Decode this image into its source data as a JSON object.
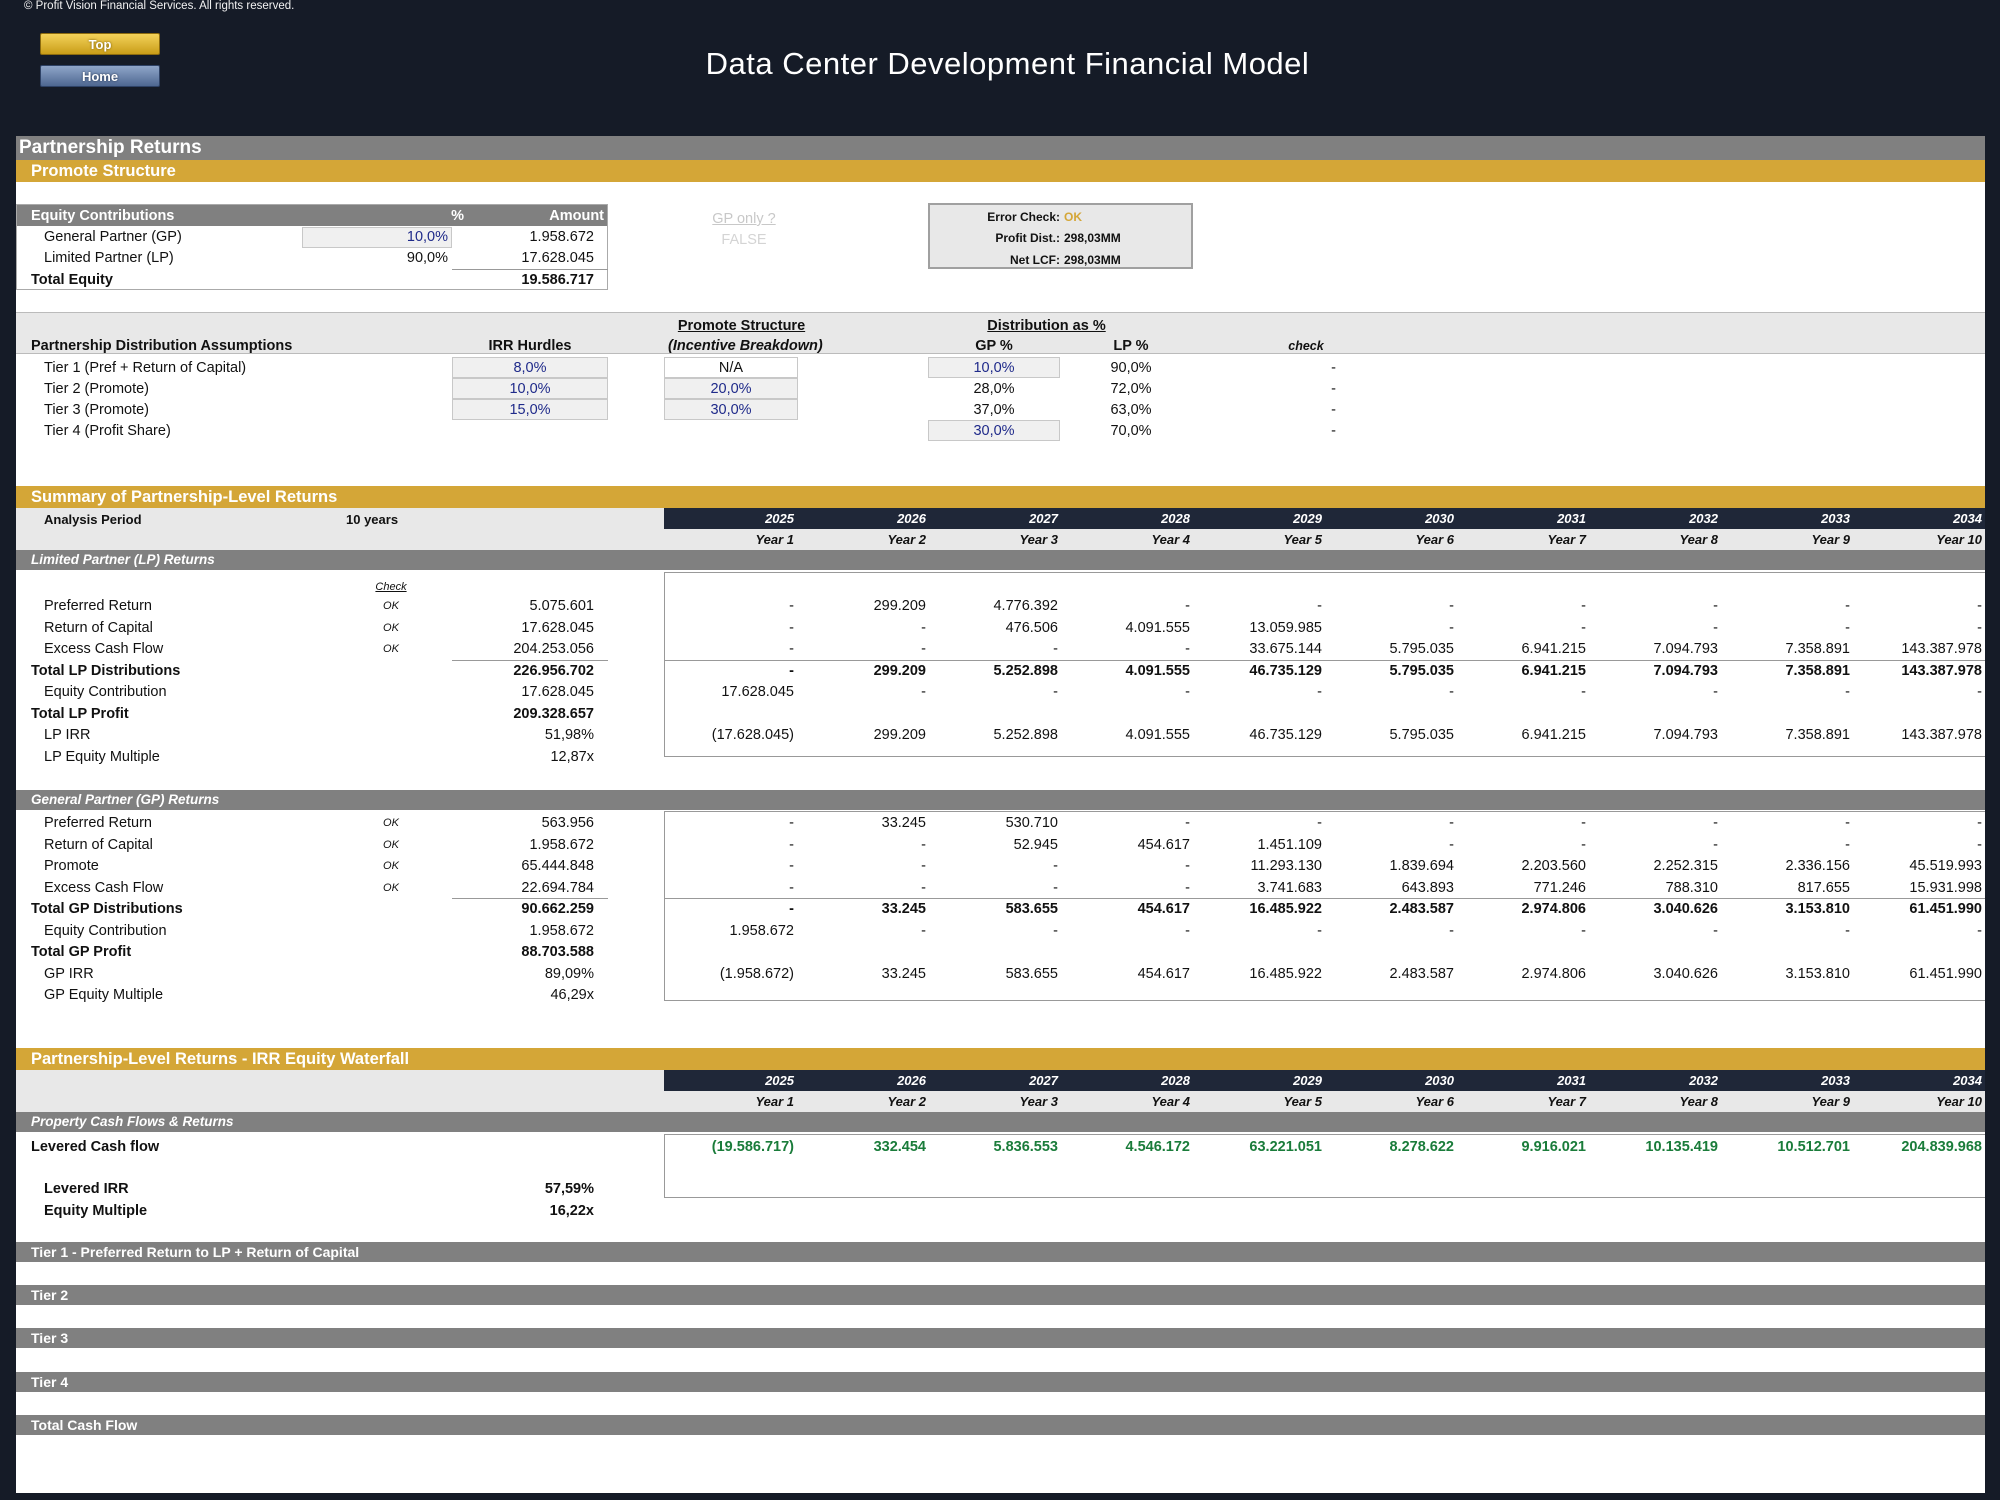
{
  "header": {
    "copyright": "© Profit Vision Financial Services. All rights reserved.",
    "title": "Data Center Development Financial Model",
    "top_button": "Top",
    "home_button": "Home"
  },
  "sections": {
    "partnership_returns": "Partnership Returns",
    "promote_structure": "Promote Structure",
    "summary": "Summary of Partnership-Level Returns",
    "waterfall": "Partnership-Level Returns - IRR Equity Waterfall",
    "tier1": "Tier 1 - Preferred Return to LP + Return of Capital",
    "tier2": "Tier 2",
    "tier3": "Tier 3",
    "tier4": "Tier 4",
    "total_cf": "Total Cash Flow"
  },
  "equity": {
    "header": {
      "label": "Equity Contributions",
      "pct": "%",
      "amount": "Amount"
    },
    "rows": [
      {
        "label": "General Partner (GP)",
        "pct": "10,0%",
        "amount": "1.958.672"
      },
      {
        "label": "Limited Partner (LP)",
        "pct": "90,0%",
        "amount": "17.628.045"
      }
    ],
    "total": {
      "label": "Total Equity",
      "amount": "19.586.717"
    },
    "gp_only_label": "GP only ?",
    "gp_only_value": "FALSE"
  },
  "error_check": {
    "error_label": "Error Check:",
    "error_value": "OK",
    "profit_label": "Profit Dist.:",
    "profit_value": "298,03MM",
    "lcf_label": "Net LCF:",
    "lcf_value": "298,03MM"
  },
  "distribution": {
    "heading_promote": "Promote Structure",
    "heading_dist": "Distribution as %",
    "col_title": "Partnership Distribution Assumptions",
    "col_irr": "IRR Hurdles",
    "col_promote": "(Incentive Breakdown)",
    "col_gp": "GP %",
    "col_lp": "LP %",
    "col_check": "check",
    "tiers": [
      {
        "label": "Tier 1 (Pref + Return of Capital)",
        "irr": "8,0%",
        "promote": "N/A",
        "gp": "10,0%",
        "lp": "90,0%",
        "check": "-"
      },
      {
        "label": "Tier 2 (Promote)",
        "irr": "10,0%",
        "promote": "20,0%",
        "gp": "28,0%",
        "lp": "72,0%",
        "check": "-"
      },
      {
        "label": "Tier 3 (Promote)",
        "irr": "15,0%",
        "promote": "30,0%",
        "gp": "37,0%",
        "lp": "63,0%",
        "check": "-"
      },
      {
        "label": "Tier 4 (Profit Share)",
        "irr": "",
        "promote": "",
        "gp": "30,0%",
        "lp": "70,0%",
        "check": "-"
      }
    ]
  },
  "analysis_period": {
    "label": "Analysis Period",
    "value": "10 years"
  },
  "years": [
    "2025",
    "2026",
    "2027",
    "2028",
    "2029",
    "2030",
    "2031",
    "2032",
    "2033",
    "2034"
  ],
  "year_labels": [
    "Year 1",
    "Year 2",
    "Year 3",
    "Year 4",
    "Year 5",
    "Year 6",
    "Year 7",
    "Year 8",
    "Year 9",
    "Year 10"
  ],
  "check_label": "Check",
  "lp": {
    "title": "Limited Partner (LP) Returns",
    "rows": [
      {
        "label": "Preferred Return",
        "check": "OK",
        "total": "5.075.601",
        "vals": [
          "-",
          "299.209",
          "4.776.392",
          "-",
          "-",
          "-",
          "-",
          "-",
          "-",
          "-"
        ]
      },
      {
        "label": "Return of Capital",
        "check": "OK",
        "total": "17.628.045",
        "vals": [
          "-",
          "-",
          "476.506",
          "4.091.555",
          "13.059.985",
          "-",
          "-",
          "-",
          "-",
          "-"
        ]
      },
      {
        "label": "Excess Cash Flow",
        "check": "OK",
        "total": "204.253.056",
        "vals": [
          "-",
          "-",
          "-",
          "-",
          "33.675.144",
          "5.795.035",
          "6.941.215",
          "7.094.793",
          "7.358.891",
          "143.387.978"
        ]
      },
      {
        "label": "Total LP Distributions",
        "bold": true,
        "total": "226.956.702",
        "vals": [
          "-",
          "299.209",
          "5.252.898",
          "4.091.555",
          "46.735.129",
          "5.795.035",
          "6.941.215",
          "7.094.793",
          "7.358.891",
          "143.387.978"
        ]
      },
      {
        "label": "Equity Contribution",
        "total": "17.628.045",
        "vals": [
          "17.628.045",
          "-",
          "-",
          "-",
          "-",
          "-",
          "-",
          "-",
          "-",
          "-"
        ]
      },
      {
        "label": "Total LP Profit",
        "bold": true,
        "total": "209.328.657",
        "vals": [
          "",
          "",
          "",
          "",
          "",
          "",
          "",
          "",
          "",
          ""
        ]
      },
      {
        "label": "LP IRR",
        "total": "51,98%",
        "vals": [
          "(17.628.045)",
          "299.209",
          "5.252.898",
          "4.091.555",
          "46.735.129",
          "5.795.035",
          "6.941.215",
          "7.094.793",
          "7.358.891",
          "143.387.978"
        ]
      },
      {
        "label": "LP Equity Multiple",
        "total": "12,87x",
        "vals": [
          "",
          "",
          "",
          "",
          "",
          "",
          "",
          "",
          "",
          ""
        ]
      }
    ]
  },
  "gp": {
    "title": "General Partner (GP) Returns",
    "rows": [
      {
        "label": "Preferred Return",
        "check": "OK",
        "total": "563.956",
        "vals": [
          "-",
          "33.245",
          "530.710",
          "-",
          "-",
          "-",
          "-",
          "-",
          "-",
          "-"
        ]
      },
      {
        "label": "Return of Capital",
        "check": "OK",
        "total": "1.958.672",
        "vals": [
          "-",
          "-",
          "52.945",
          "454.617",
          "1.451.109",
          "-",
          "-",
          "-",
          "-",
          "-"
        ]
      },
      {
        "label": "Promote",
        "check": "OK",
        "total": "65.444.848",
        "vals": [
          "-",
          "-",
          "-",
          "-",
          "11.293.130",
          "1.839.694",
          "2.203.560",
          "2.252.315",
          "2.336.156",
          "45.519.993"
        ]
      },
      {
        "label": "Excess Cash Flow",
        "check": "OK",
        "total": "22.694.784",
        "vals": [
          "-",
          "-",
          "-",
          "-",
          "3.741.683",
          "643.893",
          "771.246",
          "788.310",
          "817.655",
          "15.931.998"
        ]
      },
      {
        "label": "Total GP Distributions",
        "bold": true,
        "total": "90.662.259",
        "vals": [
          "-",
          "33.245",
          "583.655",
          "454.617",
          "16.485.922",
          "2.483.587",
          "2.974.806",
          "3.040.626",
          "3.153.810",
          "61.451.990"
        ]
      },
      {
        "label": "Equity Contribution",
        "total": "1.958.672",
        "vals": [
          "1.958.672",
          "-",
          "-",
          "-",
          "-",
          "-",
          "-",
          "-",
          "-",
          "-"
        ]
      },
      {
        "label": "Total GP Profit",
        "bold": true,
        "total": "88.703.588",
        "vals": [
          "",
          "",
          "",
          "",
          "",
          "",
          "",
          "",
          "",
          ""
        ]
      },
      {
        "label": "GP IRR",
        "total": "89,09%",
        "vals": [
          "(1.958.672)",
          "33.245",
          "583.655",
          "454.617",
          "16.485.922",
          "2.483.587",
          "2.974.806",
          "3.040.626",
          "3.153.810",
          "61.451.990"
        ]
      },
      {
        "label": "GP Equity Multiple",
        "total": "46,29x",
        "vals": [
          "",
          "",
          "",
          "",
          "",
          "",
          "",
          "",
          "",
          ""
        ]
      }
    ]
  },
  "property": {
    "title": "Property Cash Flows & Returns",
    "lcf_label": "Levered Cash flow",
    "lcf_vals": [
      "(19.586.717)",
      "332.454",
      "5.836.553",
      "4.546.172",
      "63.221.051",
      "8.278.622",
      "9.916.021",
      "10.135.419",
      "10.512.701",
      "204.839.968"
    ],
    "irr_label": "Levered IRR",
    "irr_value": "57,59%",
    "em_label": "Equity Multiple",
    "em_value": "16,22x"
  }
}
